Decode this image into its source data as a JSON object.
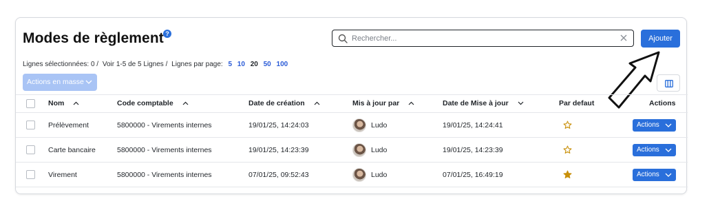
{
  "page": {
    "title": "Modes de règlement",
    "help_glyph": "?"
  },
  "search": {
    "placeholder": "Rechercher...",
    "value": ""
  },
  "toolbar": {
    "add_label": "Ajouter",
    "bulk_actions_label": "Actions en masse"
  },
  "meta": {
    "selected_text": "Lignes sélectionnées: 0 /",
    "showing_text": "Voir 1-5 de 5 Lignes /",
    "per_page_label": "Lignes par page:",
    "per_page_options": [
      "5",
      "10",
      "20",
      "50",
      "100"
    ],
    "per_page_active": "20"
  },
  "table": {
    "columns": {
      "nom": "Nom",
      "code": "Code comptable",
      "creation": "Date de création",
      "maj_par": "Mis à jour par",
      "maj_date": "Date de Mise à jour",
      "defaut": "Par defaut",
      "actions": "Actions"
    },
    "rows": [
      {
        "nom": "Prélèvement",
        "code": "5800000 - Virements internes",
        "creation": "19/01/25, 14:24:03",
        "maj_par": "Ludo",
        "maj_date": "19/01/25, 14:24:41",
        "default": false,
        "action_label": "Actions"
      },
      {
        "nom": "Carte bancaire",
        "code": "5800000 - Virements internes",
        "creation": "19/01/25, 14:23:39",
        "maj_par": "Ludo",
        "maj_date": "19/01/25, 14:23:39",
        "default": false,
        "action_label": "Actions"
      },
      {
        "nom": "Virement",
        "code": "5800000 - Virements internes",
        "creation": "07/01/25, 09:52:43",
        "maj_par": "Ludo",
        "maj_date": "07/01/25, 16:49:19",
        "default": true,
        "action_label": "Actions"
      }
    ]
  },
  "colors": {
    "primary": "#2a6fdb",
    "primary_disabled": "#a9c4f5",
    "star": "#c9900a"
  },
  "icons": [
    "help-icon",
    "search-icon",
    "clear-icon",
    "chevron-down-icon",
    "columns-icon",
    "sort-up-icon",
    "sort-down-icon",
    "star-icon",
    "arrow-annotation-icon",
    "avatar"
  ]
}
